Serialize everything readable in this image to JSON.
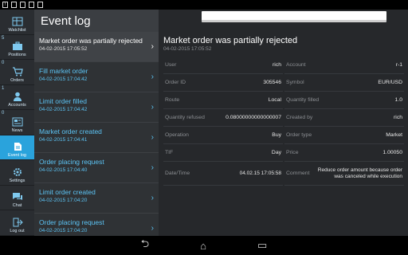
{
  "status_bar": {
    "icons": [
      "warning-icon",
      "sd-card-icon",
      "lock-icon",
      "phone-icon",
      "usb-icon"
    ]
  },
  "nav": {
    "items": [
      {
        "label": "Watchlist",
        "badge": "",
        "icon": "grid-icon",
        "active": false
      },
      {
        "label": "Positions",
        "badge": "5",
        "icon": "briefcase-icon",
        "active": false
      },
      {
        "label": "Orders",
        "badge": "0",
        "icon": "cart-icon",
        "active": false
      },
      {
        "label": "Accounts",
        "badge": "1",
        "icon": "person-icon",
        "active": false
      },
      {
        "label": "News",
        "badge": "0",
        "icon": "news-icon",
        "active": false
      },
      {
        "label": "Event log",
        "badge": "",
        "icon": "event-icon",
        "active": true
      },
      {
        "label": "Settings",
        "badge": "",
        "icon": "gear-icon",
        "active": false
      },
      {
        "label": "Chat",
        "badge": "",
        "icon": "chat-icon",
        "active": false
      },
      {
        "label": "Log out",
        "badge": "",
        "icon": "logout-icon",
        "active": false
      }
    ]
  },
  "header": {
    "title": "Event log"
  },
  "events": [
    {
      "title": "Market order was partially rejected",
      "date": "04-02-2015 17:05:52"
    },
    {
      "title": "Fill market order",
      "date": "04-02-2015 17:04:42"
    },
    {
      "title": "Limit order filled",
      "date": "04-02-2015 17:04:42"
    },
    {
      "title": "Market order created",
      "date": "04-02-2015 17:04:41"
    },
    {
      "title": "Order placing request",
      "date": "04-02-2015 17:04:40"
    },
    {
      "title": "Limit order created",
      "date": "04-02-2015 17:04:20"
    },
    {
      "title": "Order placing request",
      "date": "04-02-2015 17:04:20"
    }
  ],
  "detail": {
    "title": "Market order was partially rejected",
    "date": "04-02-2015 17:05:52",
    "left": [
      {
        "k": "User",
        "v": "rich"
      },
      {
        "k": "Order ID",
        "v": "305546"
      },
      {
        "k": "Route",
        "v": "Local"
      },
      {
        "k": "Quantity refused",
        "v": "0.08000000000000007"
      },
      {
        "k": "Operation",
        "v": "Buy"
      },
      {
        "k": "TIF",
        "v": "Day"
      },
      {
        "k": "Date/Time",
        "v": "04.02.15 17:05:58"
      }
    ],
    "right": [
      {
        "k": "Account",
        "v": "r-1"
      },
      {
        "k": "Symbol",
        "v": "EUR/USD"
      },
      {
        "k": "Quantity filled",
        "v": "1.0"
      },
      {
        "k": "Created by",
        "v": "rich"
      },
      {
        "k": "Order type",
        "v": "Market"
      },
      {
        "k": "Price",
        "v": "1.00050"
      },
      {
        "k": "Comment",
        "v": "Reduce order amount because order was canceled while execution"
      }
    ]
  },
  "system_nav": {
    "icons": [
      "back-icon",
      "home-icon",
      "recents-icon"
    ]
  }
}
